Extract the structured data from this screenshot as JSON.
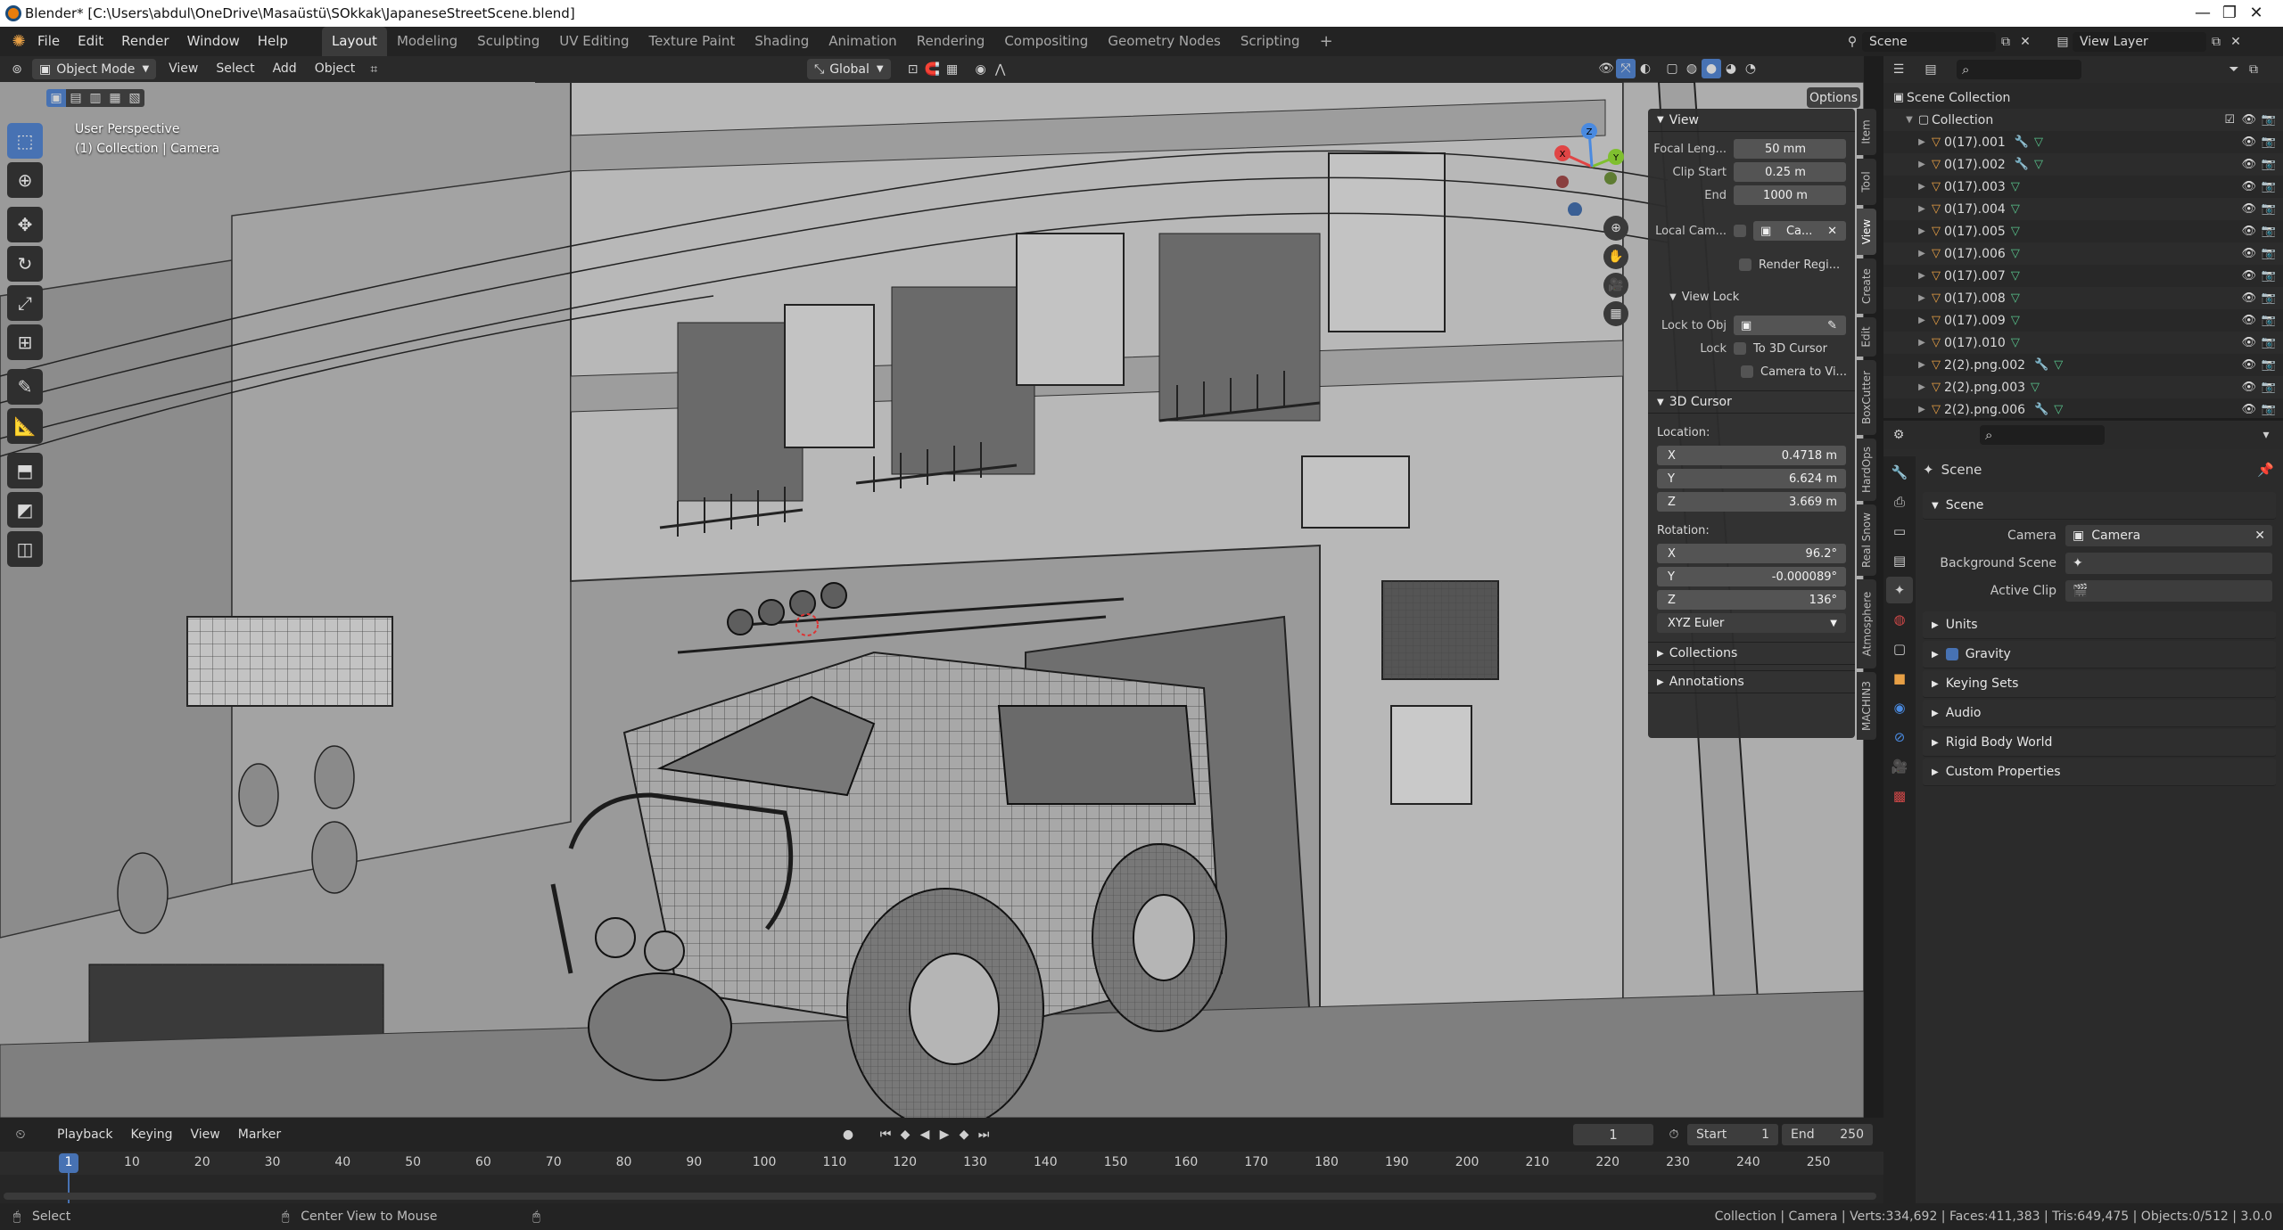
{
  "window": {
    "title": "Blender* [C:\\Users\\abdul\\OneDrive\\Masaüstü\\SOkkak\\JapaneseStreetScene.blend]",
    "minimize": "—",
    "maximize": "❐",
    "close": "✕"
  },
  "menubar": {
    "menus": [
      "File",
      "Edit",
      "Render",
      "Window",
      "Help"
    ],
    "workspaces": [
      "Layout",
      "Modeling",
      "Sculpting",
      "UV Editing",
      "Texture Paint",
      "Shading",
      "Animation",
      "Rendering",
      "Compositing",
      "Geometry Nodes",
      "Scripting"
    ],
    "active_workspace": "Layout",
    "add_workspace": "+",
    "scene_name": "Scene",
    "view_layer": "View Layer"
  },
  "viewport_header": {
    "mode": "Object Mode",
    "menus": [
      "View",
      "Select",
      "Add",
      "Object"
    ],
    "orientation": "Global",
    "options": "Options"
  },
  "viewport": {
    "perspective": "User Perspective",
    "collection_camera": "(1) Collection | Camera",
    "gizmo_axes": [
      "X",
      "Y",
      "Z"
    ]
  },
  "npanel": {
    "view_header": "View",
    "focal_length_label": "Focal Leng...",
    "focal_length_value": "50 mm",
    "clip_start_label": "Clip Start",
    "clip_start_value": "0.25 m",
    "clip_end_label": "End",
    "clip_end_value": "1000 m",
    "local_camera_label": "Local Cam...",
    "local_camera_value": "Ca...",
    "render_region": "Render Regi...",
    "view_lock_header": "View Lock",
    "lock_to_obj_label": "Lock to Obj",
    "lock_label": "Lock",
    "to_3d_cursor": "To 3D Cursor",
    "camera_to_view": "Camera to Vi...",
    "cursor_header": "3D Cursor",
    "location_label": "Location:",
    "loc_x": "0.4718 m",
    "loc_y": "6.624 m",
    "loc_z": "3.669 m",
    "rotation_label": "Rotation:",
    "rot_x": "96.2°",
    "rot_y": "-0.000089°",
    "rot_z": "136°",
    "rotation_mode": "XYZ Euler",
    "collections_header": "Collections",
    "annotations_header": "Annotations",
    "axis_x": "X",
    "axis_y": "Y",
    "axis_z": "Z"
  },
  "npanel_tabs": [
    "Item",
    "Tool",
    "View",
    "Create",
    "Edit",
    "BoxCutter",
    "HardOps",
    "Real Snow",
    "Atmosphere",
    "MACHIN3"
  ],
  "npanel_active_tab": "View",
  "outliner": {
    "scene_collection": "Scene Collection",
    "collection": "Collection",
    "items": [
      {
        "name": "0(17).001",
        "modifier": true
      },
      {
        "name": "0(17).002",
        "modifier": true
      },
      {
        "name": "0(17).003",
        "modifier": false
      },
      {
        "name": "0(17).004",
        "modifier": false
      },
      {
        "name": "0(17).005",
        "modifier": false
      },
      {
        "name": "0(17).006",
        "modifier": false
      },
      {
        "name": "0(17).007",
        "modifier": false
      },
      {
        "name": "0(17).008",
        "modifier": false
      },
      {
        "name": "0(17).009",
        "modifier": false
      },
      {
        "name": "0(17).010",
        "modifier": false
      },
      {
        "name": "2(2).png.002",
        "modifier": true
      },
      {
        "name": "2(2).png.003",
        "modifier": false
      },
      {
        "name": "2(2).png.006",
        "modifier": true
      }
    ]
  },
  "properties": {
    "context": "Scene",
    "panel_scene": "Scene",
    "camera_label": "Camera",
    "camera_value": "Camera",
    "background_scene_label": "Background Scene",
    "active_clip_label": "Active Clip",
    "panels": [
      "Units",
      "Gravity",
      "Keying Sets",
      "Audio",
      "Rigid Body World",
      "Custom Properties"
    ]
  },
  "timeline": {
    "menus": [
      "Playback",
      "Keying",
      "View",
      "Marker"
    ],
    "current_frame": "1",
    "start_label": "Start",
    "start_value": "1",
    "end_label": "End",
    "end_value": "250",
    "ruler": [
      "1",
      "10",
      "20",
      "30",
      "40",
      "50",
      "60",
      "70",
      "80",
      "90",
      "100",
      "110",
      "120",
      "130",
      "140",
      "150",
      "160",
      "170",
      "180",
      "190",
      "200",
      "210",
      "220",
      "230",
      "240",
      "250"
    ]
  },
  "statusbar": {
    "left_action": "Select",
    "middle_action": "Center View to Mouse",
    "stats": "Collection | Camera | Verts:334,692 | Faces:411,383 | Tris:649,475 | Objects:0/512 | 3.0.0"
  }
}
